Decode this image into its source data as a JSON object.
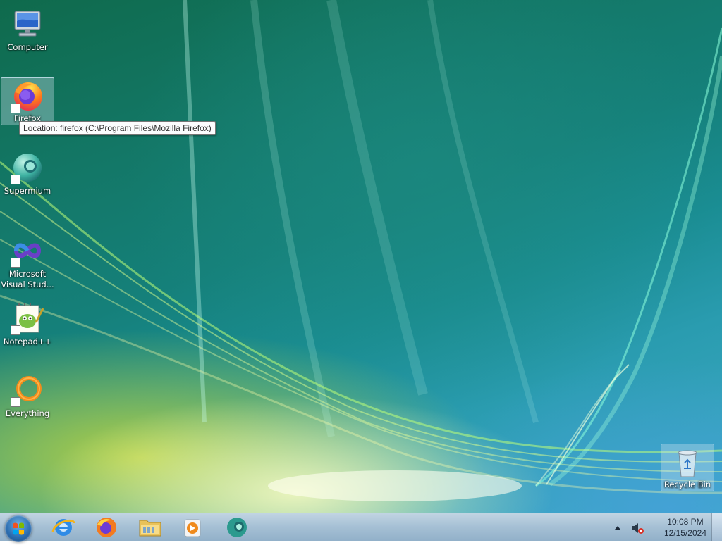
{
  "desktop": {
    "icons": [
      {
        "label": "Computer",
        "icon": "computer-icon"
      },
      {
        "label": "Firefox",
        "icon": "firefox-icon"
      },
      {
        "label": "Supermium",
        "icon": "supermium-icon"
      },
      {
        "label": "Microsoft Visual Stud...",
        "icon": "visual-studio-icon"
      },
      {
        "label": "Notepad++",
        "icon": "notepadpp-icon"
      },
      {
        "label": "Everything",
        "icon": "everything-icon"
      },
      {
        "label": "Recycle Bin",
        "icon": "recycle-bin-icon"
      }
    ],
    "tooltip": "Location: firefox (C:\\Program Files\\Mozilla Firefox)"
  },
  "taskbar": {
    "start_icon": "windows-start-icon",
    "pinned": [
      {
        "name": "Internet Explorer",
        "icon": "internet-explorer-icon"
      },
      {
        "name": "Firefox",
        "icon": "firefox-icon"
      },
      {
        "name": "Windows Explorer",
        "icon": "folder-icon"
      },
      {
        "name": "Windows Media Player",
        "icon": "media-player-icon"
      },
      {
        "name": "Supermium",
        "icon": "supermium-icon"
      }
    ],
    "tray": {
      "time": "10:08 PM",
      "date": "12/15/2024",
      "volume_icon": "volume-muted-icon",
      "overflow_icon": "show-hidden-icons-arrow"
    }
  }
}
